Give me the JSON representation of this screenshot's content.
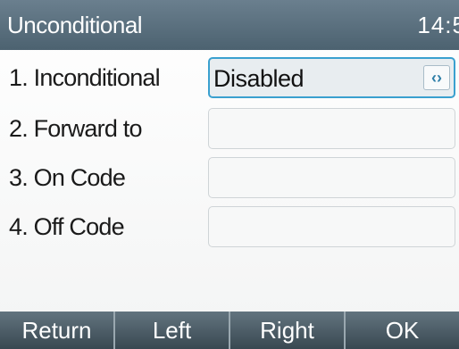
{
  "header": {
    "title": "Unconditional",
    "time": "14:5"
  },
  "form": {
    "rows": [
      {
        "label": "1. Inconditional",
        "value": "Disabled",
        "toggle_icon": "left-right-arrows-icon"
      },
      {
        "label": "2. Forward to",
        "value": ""
      },
      {
        "label": "3. On Code",
        "value": ""
      },
      {
        "label": "4. Off Code",
        "value": ""
      }
    ]
  },
  "softkeys": [
    "Return",
    "Left",
    "Right",
    "OK"
  ],
  "colors": {
    "titlebar": "#566b79",
    "softkey_bar": "#4b5c66",
    "selection_border": "#3aa0cf"
  }
}
